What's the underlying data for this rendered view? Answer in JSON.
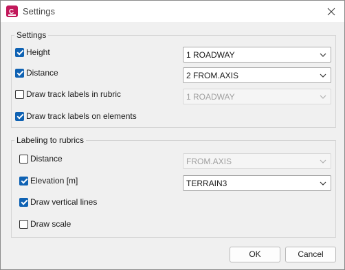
{
  "window": {
    "title": "Settings"
  },
  "settings_group": {
    "title": "Settings",
    "height": {
      "label": "Height",
      "checked": true,
      "value": "1 ROADWAY"
    },
    "distance": {
      "label": "Distance",
      "checked": true,
      "value": "2 FROM.AXIS"
    },
    "track_labels_rubric": {
      "label": "Draw track labels in rubric",
      "checked": false,
      "value": "1 ROADWAY"
    },
    "track_labels_elements": {
      "label": "Draw track labels on elements",
      "checked": true
    }
  },
  "rubric_group": {
    "title": "Labeling to rubrics",
    "distance": {
      "label": "Distance",
      "checked": false,
      "value": "FROM.AXIS"
    },
    "elevation": {
      "label": "Elevation [m]",
      "checked": true,
      "value": "TERRAIN3"
    },
    "vertical_lines": {
      "label": "Draw vertical lines",
      "checked": true
    },
    "scale": {
      "label": "Draw scale",
      "checked": false
    }
  },
  "buttons": {
    "ok": "OK",
    "cancel": "Cancel"
  },
  "colors": {
    "accent": "#0f62b3",
    "app_icon": "#c2185b"
  }
}
